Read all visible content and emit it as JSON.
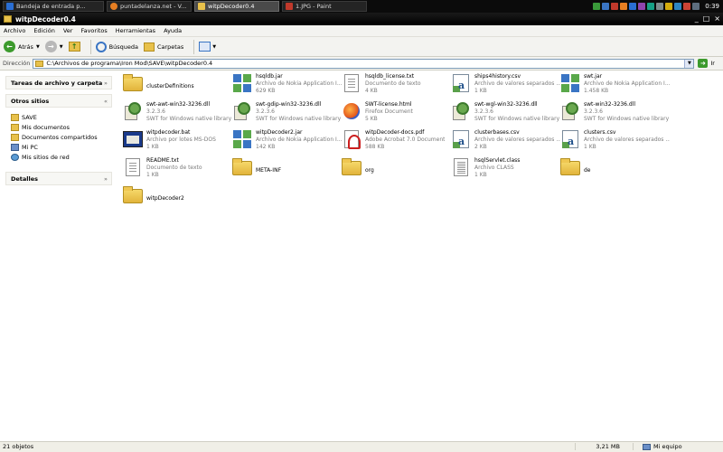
{
  "taskbar": {
    "buttons": [
      {
        "label": "Bandeja de entrada p...",
        "color": "#2a6ed3"
      },
      {
        "label": "puntadelanza.net - V...",
        "color": "#e67e22"
      },
      {
        "label": "witpDecoder0.4",
        "color": "#e8c14b"
      },
      {
        "label": "1.JPG - Paint",
        "color": "#c0392b"
      }
    ],
    "clock": "0:39"
  },
  "window": {
    "title": "witpDecoder0.4",
    "ctrl_min": "_",
    "ctrl_max": "□",
    "ctrl_close": "×"
  },
  "menu": [
    "Archivo",
    "Edición",
    "Ver",
    "Favoritos",
    "Herramientas",
    "Ayuda"
  ],
  "toolbar": {
    "back_label": "Atrás",
    "search_label": "Búsqueda",
    "folders_label": "Carpetas"
  },
  "address": {
    "label": "Dirección",
    "value": "C:\\Archivos de programa\\Iron Mod\\SAVE\\witpDecoder0.4",
    "go_label": "Ir"
  },
  "sidebar": {
    "tasks_title": "Tareas de archivo y carpeta",
    "other_title": "Otros sitios",
    "places": [
      {
        "label": "SAVE",
        "icon": "folder-icon"
      },
      {
        "label": "Mis documentos",
        "icon": "folder-icon"
      },
      {
        "label": "Documentos compartidos",
        "icon": "folder-icon"
      },
      {
        "label": "Mi PC",
        "icon": "computer-icon"
      },
      {
        "label": "Mis sitios de red",
        "icon": "network-icon"
      }
    ],
    "details_title": "Detalles"
  },
  "files": [
    {
      "name": "clusterDefinitions",
      "type": "",
      "size": "",
      "icon": "folder"
    },
    {
      "name": "hsqldb.jar",
      "type": "Archivo de Nokia Application I...",
      "size": "629 KB",
      "icon": "jar"
    },
    {
      "name": "hsqldb_license.txt",
      "type": "Documento de texto",
      "size": "4 KB",
      "icon": "doc"
    },
    {
      "name": "ships4history.csv",
      "type": "Archivo de valores separados ...",
      "size": "1 KB",
      "icon": "csv"
    },
    {
      "name": "swt.jar",
      "type": "Archivo de Nokia Application I...",
      "size": "1.458 KB",
      "icon": "jar"
    },
    {
      "name": "swt-awt-win32-3236.dll",
      "type": "3.2.3.6",
      "size": "SWT for Windows native library",
      "icon": "dll"
    },
    {
      "name": "swt-gdip-win32-3236.dll",
      "type": "3.2.3.6",
      "size": "SWT for Windows native library",
      "icon": "dll"
    },
    {
      "name": "SWT-license.html",
      "type": "Firefox Document",
      "size": "5 KB",
      "icon": "html"
    },
    {
      "name": "swt-wgl-win32-3236.dll",
      "type": "3.2.3.6",
      "size": "SWT for Windows native library",
      "icon": "dll"
    },
    {
      "name": "swt-win32-3236.dll",
      "type": "3.2.3.6",
      "size": "SWT for Windows native library",
      "icon": "dll"
    },
    {
      "name": "witpdecoder.bat",
      "type": "Archivo por lotes MS-DOS",
      "size": "1 KB",
      "icon": "bat"
    },
    {
      "name": "witpDecoder2.jar",
      "type": "Archivo de Nokia Application I...",
      "size": "142 KB",
      "icon": "jar"
    },
    {
      "name": "witpDecoder-docs.pdf",
      "type": "Adobe Acrobat 7.0 Document",
      "size": "588 KB",
      "icon": "pdf"
    },
    {
      "name": "clusterbases.csv",
      "type": "Archivo de valores separados ...",
      "size": "2 KB",
      "icon": "csv"
    },
    {
      "name": "clusters.csv",
      "type": "Archivo de valores separados ...",
      "size": "1 KB",
      "icon": "csv"
    },
    {
      "name": "README.txt",
      "type": "Documento de texto",
      "size": "1 KB",
      "icon": "doc"
    },
    {
      "name": "META-INF",
      "type": "",
      "size": "",
      "icon": "folder"
    },
    {
      "name": "org",
      "type": "",
      "size": "",
      "icon": "folder"
    },
    {
      "name": "hsqlServlet.class",
      "type": "Archivo CLASS",
      "size": "1 KB",
      "icon": "class"
    },
    {
      "name": "de",
      "type": "",
      "size": "",
      "icon": "folder"
    },
    {
      "name": "witpDecoder2",
      "type": "",
      "size": "",
      "icon": "folder"
    }
  ],
  "status": {
    "count": "21 objetos",
    "size": "3,21 MB",
    "location": "Mi equipo"
  }
}
